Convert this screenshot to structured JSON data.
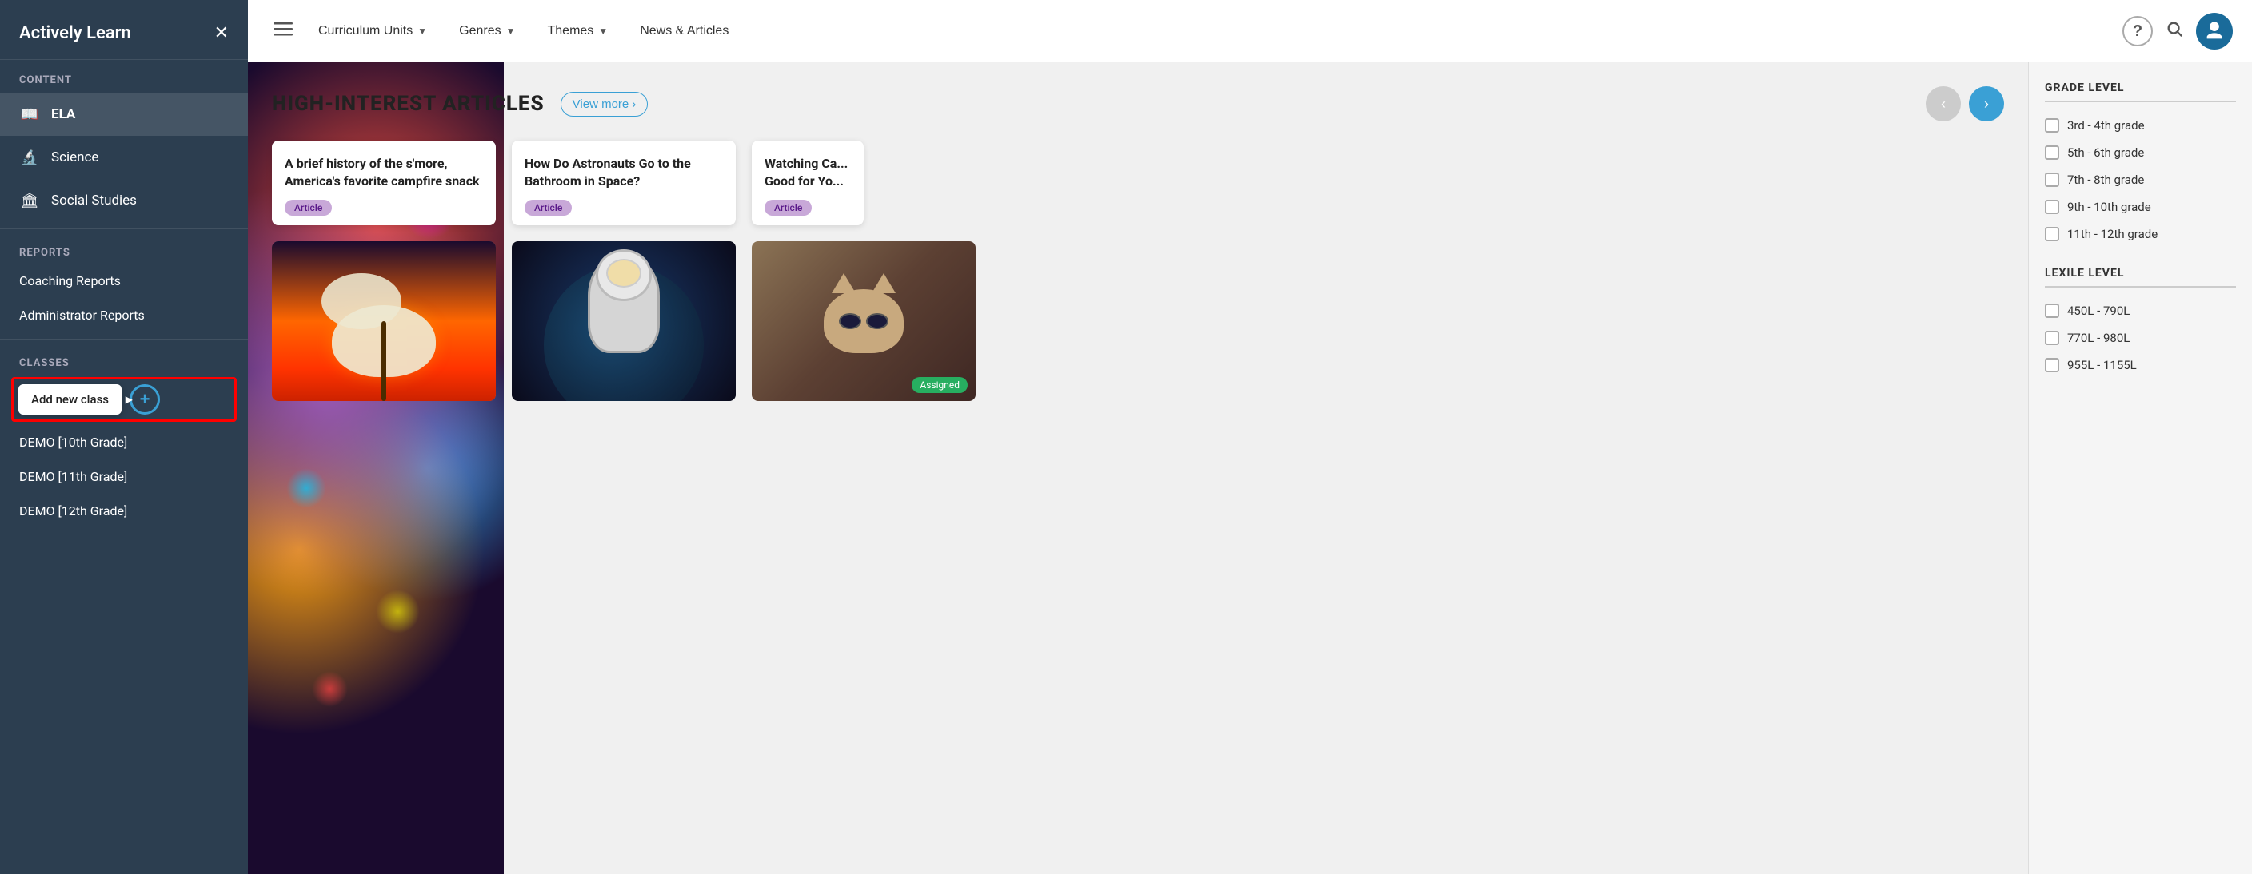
{
  "sidebar": {
    "logo": "Actively Learn",
    "close_label": "✕",
    "content_label": "CONTENT",
    "nav_items": [
      {
        "id": "ela",
        "label": "ELA",
        "icon": "📖",
        "active": true
      },
      {
        "id": "science",
        "label": "Science",
        "icon": "🔬",
        "active": false
      },
      {
        "id": "social-studies",
        "label": "Social Studies",
        "icon": "🏛",
        "active": false
      }
    ],
    "reports_label": "REPORTS",
    "report_links": [
      {
        "id": "coaching",
        "label": "Coaching Reports"
      },
      {
        "id": "admin",
        "label": "Administrator Reports"
      }
    ],
    "classes_label": "CLASSES",
    "add_class_tooltip": "Add new class",
    "class_items": [
      {
        "id": "demo10",
        "label": "DEMO [10th Grade]"
      },
      {
        "id": "demo11",
        "label": "DEMO [11th Grade]"
      },
      {
        "id": "demo12",
        "label": "DEMO [12th Grade]"
      }
    ]
  },
  "top_nav": {
    "menu_icon": "☰",
    "nav_items": [
      {
        "id": "curriculum-units",
        "label": "Curriculum Units",
        "has_dropdown": true
      },
      {
        "id": "genres",
        "label": "Genres",
        "has_dropdown": true
      },
      {
        "id": "themes",
        "label": "Themes",
        "has_dropdown": true
      },
      {
        "id": "news-articles",
        "label": "News & Articles",
        "has_dropdown": false
      }
    ],
    "help_icon": "?",
    "search_icon": "🔍"
  },
  "main_content": {
    "section_title": "HIGH-INTEREST ARTICLES",
    "view_more_label": "View more",
    "view_more_arrow": "›",
    "carousel_prev": "‹",
    "carousel_next": "›",
    "top_articles": [
      {
        "id": "smores",
        "title": "A brief history of the s'more, America's favorite campfire snack",
        "badge": "Article"
      },
      {
        "id": "astronauts",
        "title": "How Do Astronauts Go to the Bathroom in Space?",
        "badge": "Article"
      },
      {
        "id": "watching",
        "title": "Watching Ca... Good for Yo...",
        "badge": "Article"
      }
    ],
    "image_cards": [
      {
        "id": "marshmallow-img",
        "type": "marshmallow",
        "assigned": false
      },
      {
        "id": "astronaut-img",
        "type": "astronaut",
        "assigned": false
      },
      {
        "id": "cat-img",
        "type": "cat",
        "assigned": true,
        "assigned_label": "Assigned"
      }
    ]
  },
  "filter_panel": {
    "grade_level_title": "GRADE LEVEL",
    "grade_options": [
      {
        "id": "grade-3-4",
        "label": "3rd - 4th grade"
      },
      {
        "id": "grade-5-6",
        "label": "5th - 6th grade"
      },
      {
        "id": "grade-7-8",
        "label": "7th - 8th grade"
      },
      {
        "id": "grade-9-10",
        "label": "9th - 10th grade"
      },
      {
        "id": "grade-11-12",
        "label": "11th - 12th grade"
      }
    ],
    "lexile_level_title": "LEXILE LEVEL",
    "lexile_options": [
      {
        "id": "lexile-450-790",
        "label": "450L - 790L"
      },
      {
        "id": "lexile-770-980",
        "label": "770L - 980L"
      },
      {
        "id": "lexile-955-1155",
        "label": "955L - 1155L"
      }
    ]
  },
  "colors": {
    "sidebar_bg": "#2c3e50",
    "accent_blue": "#3aa0d5",
    "article_badge_bg": "#c8a8d8",
    "assigned_green": "#27ae60",
    "user_avatar_bg": "#1a6b9a"
  }
}
